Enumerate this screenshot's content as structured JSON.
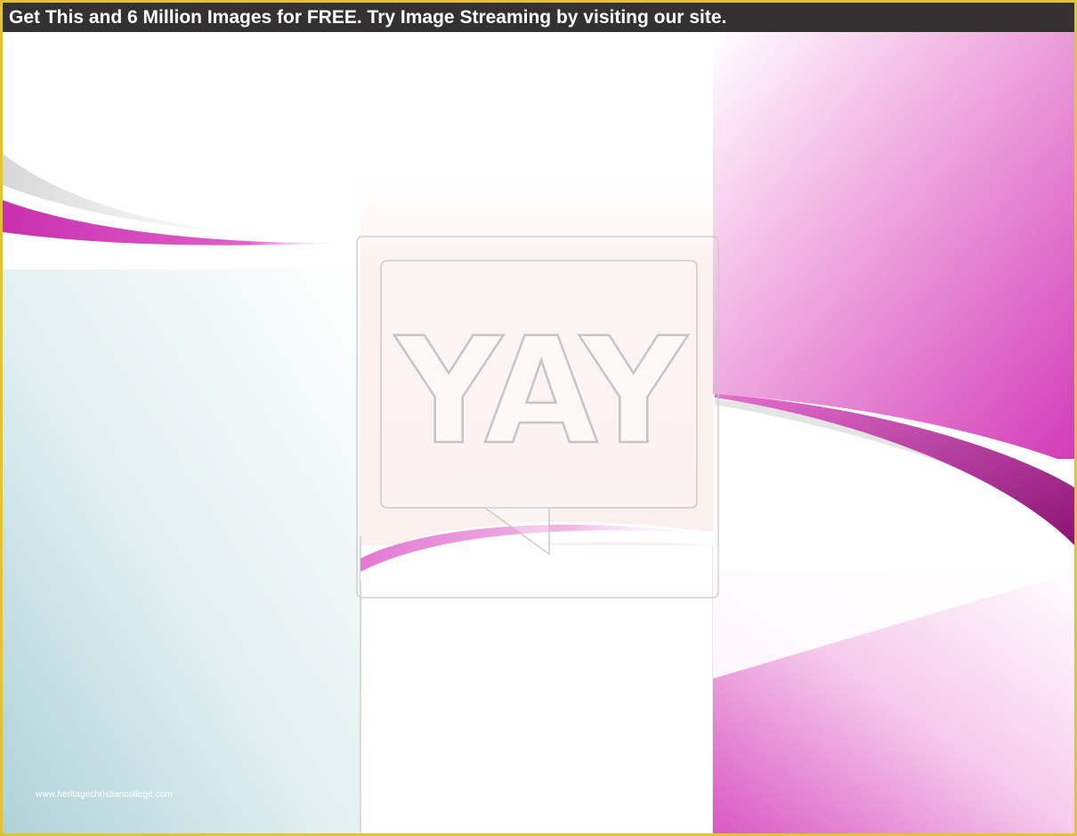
{
  "banner": {
    "text": "Get This and 6 Million Images for FREE. Try Image Streaming by visiting our site."
  },
  "watermark": {
    "text": "YAY"
  },
  "footer": {
    "url": "www.heritagechristiancollege.com"
  },
  "colors": {
    "frame_border": "#e2c430",
    "banner_background": "#333132",
    "banner_text": "#ffffff",
    "magenta": "#d23cb8",
    "teal_tint": "#b7d8dc"
  }
}
